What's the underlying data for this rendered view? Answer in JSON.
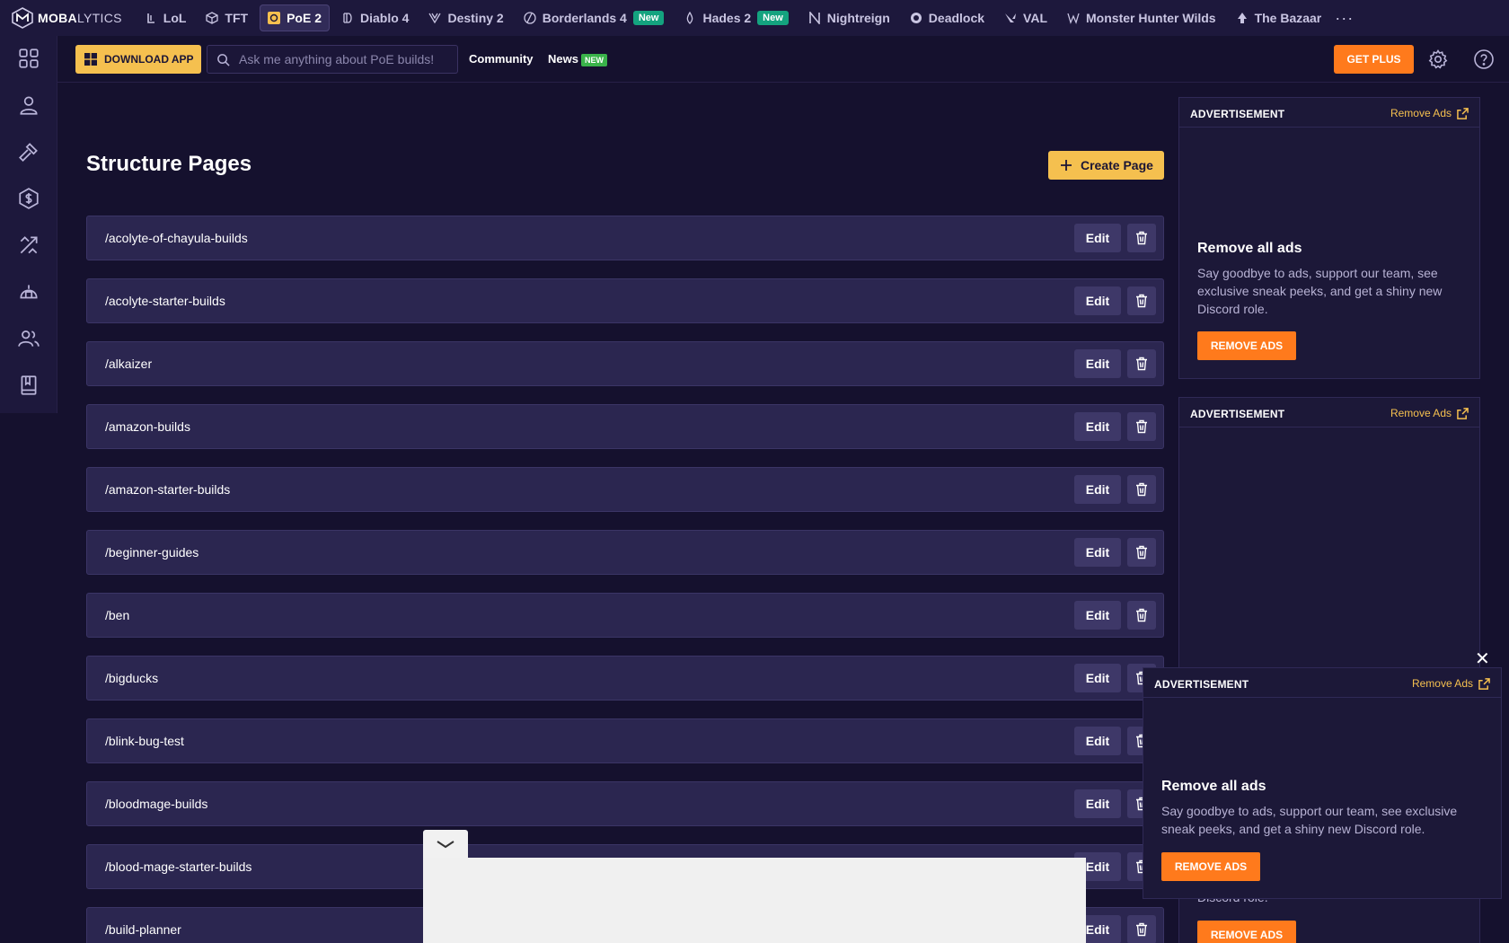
{
  "brand": {
    "strong": "MOBA",
    "light": "LYTICS"
  },
  "games": [
    {
      "label": "LoL",
      "icon": "lol-icon",
      "active": false,
      "badge": ""
    },
    {
      "label": "TFT",
      "icon": "tft-icon",
      "active": false,
      "badge": ""
    },
    {
      "label": "PoE 2",
      "icon": "poe2-icon",
      "active": true,
      "badge": ""
    },
    {
      "label": "Diablo 4",
      "icon": "diablo-icon",
      "active": false,
      "badge": ""
    },
    {
      "label": "Destiny 2",
      "icon": "destiny-icon",
      "active": false,
      "badge": ""
    },
    {
      "label": "Borderlands 4",
      "icon": "borderlands-icon",
      "active": false,
      "badge": "New"
    },
    {
      "label": "Hades 2",
      "icon": "hades-icon",
      "active": false,
      "badge": "New"
    },
    {
      "label": "Nightreign",
      "icon": "nightreign-icon",
      "active": false,
      "badge": ""
    },
    {
      "label": "Deadlock",
      "icon": "deadlock-icon",
      "active": false,
      "badge": ""
    },
    {
      "label": "VAL",
      "icon": "valorant-icon",
      "active": false,
      "badge": ""
    },
    {
      "label": "Monster Hunter Wilds",
      "icon": "monster-hunter-icon",
      "active": false,
      "badge": ""
    },
    {
      "label": "The Bazaar",
      "icon": "bazaar-icon",
      "active": false,
      "badge": ""
    }
  ],
  "more_label": "···",
  "subbar": {
    "download_label": "DOWNLOAD APP",
    "search_placeholder": "Ask me anything about PoE builds!",
    "community_label": "Community",
    "news_label": "News",
    "news_badge": "NEW",
    "getplus_label": "GET PLUS"
  },
  "main": {
    "title": "Structure Pages",
    "create_label": "Create Page",
    "edit_label": "Edit",
    "pages": [
      "/acolyte-of-chayula-builds",
      "/acolyte-starter-builds",
      "/alkaizer",
      "/amazon-builds",
      "/amazon-starter-builds",
      "/beginner-guides",
      "/ben",
      "/bigducks",
      "/blink-bug-test",
      "/bloodmage-builds",
      "/blood-mage-starter-builds",
      "/build-planner"
    ]
  },
  "ads": {
    "label": "ADVERTISEMENT",
    "remove_link": "Remove Ads",
    "title": "Remove all ads",
    "desc": "Say goodbye to ads, support our team, see exclusive sneak peeks, and get a shiny new Discord role.",
    "button": "REMOVE ADS",
    "close": "✕",
    "partial_text": "Discord role."
  },
  "colors": {
    "accent": "#f5c04f",
    "cta": "#ff7a1c",
    "bg": "#15112e",
    "new_badge": "#14a37f"
  }
}
